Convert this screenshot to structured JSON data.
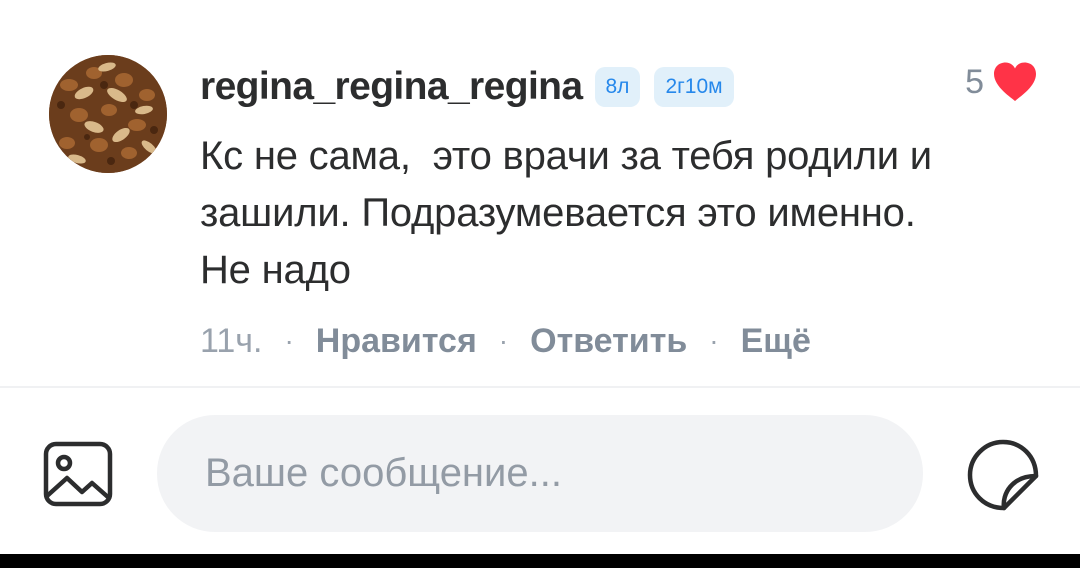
{
  "comment": {
    "author": "regina_regina_regina",
    "badges": [
      "8л",
      "2г10м"
    ],
    "likes": "5",
    "liked": true,
    "text": "Кс не сама,  это врачи за тебя родили и\nзашили. Подразумевается это именно.\nНе надо",
    "time": "11ч.",
    "separator": "·",
    "actions": {
      "like": "Нравится",
      "reply": "Ответить",
      "more": "Ещё"
    }
  },
  "composer": {
    "placeholder": "Ваше сообщение..."
  },
  "icons": {
    "attach": "image-icon",
    "sticker": "sticker-icon",
    "like": "heart-icon"
  },
  "colors": {
    "text_primary": "#2c2d2e",
    "text_secondary": "#818c99",
    "accent": "#2688eb",
    "badge_bg": "#e1f0fa",
    "heart": "#ff3347",
    "input_bg": "#f2f3f5"
  }
}
